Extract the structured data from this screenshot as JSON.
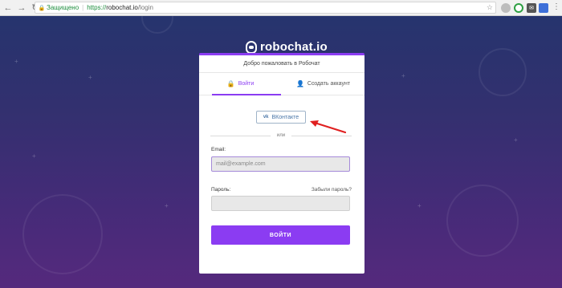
{
  "browser": {
    "secure_label": "Защищено",
    "url_scheme": "https://",
    "url_host": "robochat.io",
    "url_path": "/login"
  },
  "logo": {
    "text": "robochat.io"
  },
  "card": {
    "header": "Добро пожаловать в Робочат",
    "tabs": [
      {
        "label": "Войти",
        "active": true
      },
      {
        "label": "Создать аккаунт",
        "active": false
      }
    ],
    "social": {
      "vk_logo": "vk",
      "vk_label": "ВКонтакте"
    },
    "divider": "или",
    "email": {
      "label": "Email:",
      "placeholder": "mail@example.com"
    },
    "password": {
      "label": "Пароль:",
      "forgot": "Забыли пароль?"
    },
    "submit": "ВОЙТИ"
  },
  "colors": {
    "accent": "#8b3cf2",
    "annotation": "#e02020"
  }
}
